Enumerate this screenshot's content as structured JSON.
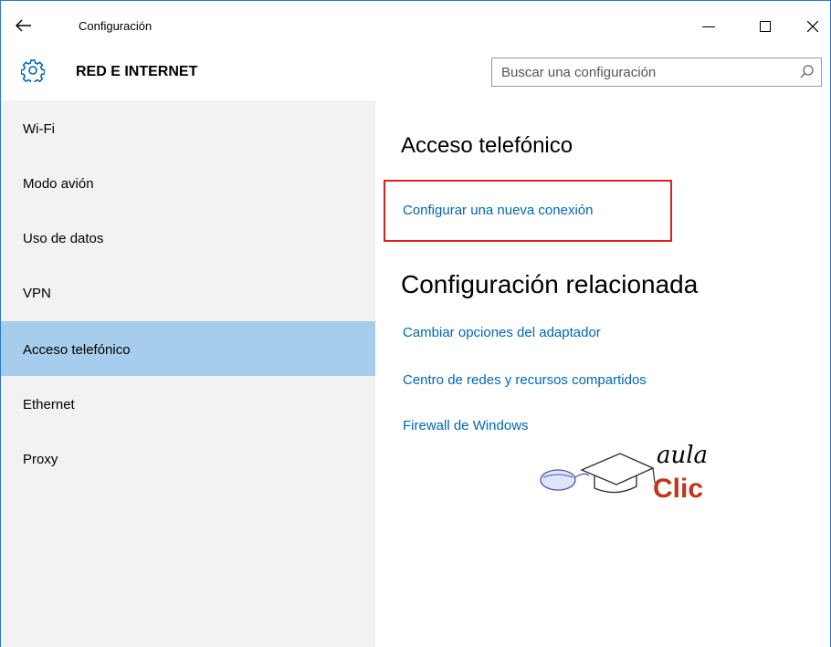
{
  "window": {
    "app_title": "Configuración",
    "back_icon": "back-arrow-icon",
    "controls": [
      "minimize-icon",
      "maximize-icon",
      "close-icon"
    ]
  },
  "header": {
    "section_title": "RED E INTERNET",
    "icon": "gear-icon",
    "search_placeholder": "Buscar una configuración",
    "search_icon": "search-icon"
  },
  "sidebar": {
    "items": [
      {
        "label": "Wi-Fi"
      },
      {
        "label": "Modo avión"
      },
      {
        "label": "Uso de datos"
      },
      {
        "label": "VPN"
      },
      {
        "label": "Acceso telefónico"
      },
      {
        "label": "Ethernet"
      },
      {
        "label": "Proxy"
      }
    ],
    "selected_index": 4
  },
  "main": {
    "heading": "Acceso telefónico",
    "primary_link": "Configurar una nueva conexión",
    "related_heading": "Configuración relacionada",
    "related_links": [
      "Cambiar opciones del adaptador",
      "Centro de redes y recursos compartidos",
      "Firewall de Windows"
    ]
  },
  "watermark": {
    "line1": "aula",
    "line2": "Clic"
  },
  "colors": {
    "link": "#0067b8",
    "selected": "#a6cdeb",
    "sidebar_bg": "#f2f2f2",
    "highlight_border": "#e0201b",
    "logo_red": "#c0351b"
  }
}
